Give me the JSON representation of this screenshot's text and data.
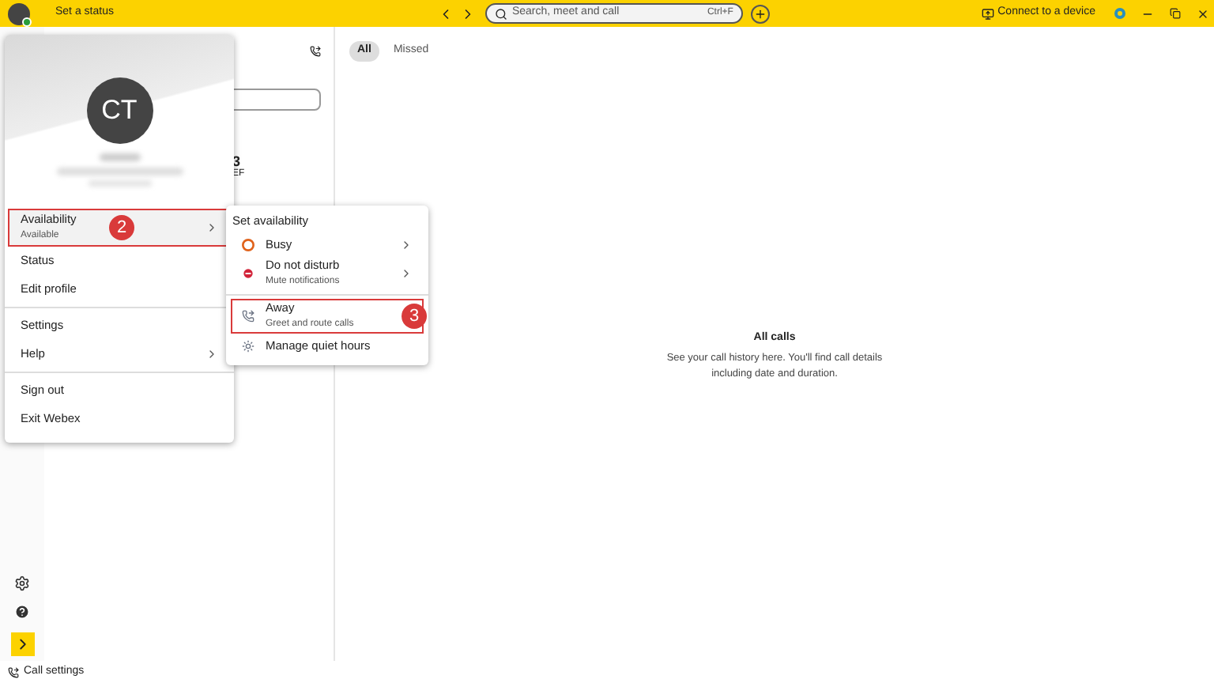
{
  "top_bar": {
    "status_text": "Set a status",
    "search": {
      "placeholder": "Search, meet and call",
      "shortcut": "Ctrl+F"
    },
    "connect": "Connect to a device"
  },
  "calls_panel": {
    "dialpad_key": {
      "digit": "3",
      "letters": "EF"
    }
  },
  "history": {
    "tabs": [
      {
        "label": "All",
        "selected": true
      },
      {
        "label": "Missed",
        "selected": false
      }
    ],
    "empty_title": "All calls",
    "empty_text": "See your call history here. You'll find call details including date and duration."
  },
  "footer": {
    "label": "Call settings"
  },
  "profile_menu": {
    "initials": "CT",
    "groups": [
      {
        "items": [
          {
            "label": "Availability",
            "sublabel": "Available",
            "submenu": true,
            "highlighted": true,
            "badge": "2"
          },
          {
            "label": "Status",
            "submenu": false,
            "highlighted": false
          },
          {
            "label": "Edit profile",
            "submenu": false,
            "highlighted": false
          }
        ]
      },
      {
        "items": [
          {
            "label": "Settings",
            "submenu": false,
            "highlighted": false
          },
          {
            "label": "Help",
            "submenu": true,
            "highlighted": false
          }
        ]
      },
      {
        "items": [
          {
            "label": "Sign out",
            "submenu": false,
            "highlighted": false
          },
          {
            "label": "Exit Webex",
            "submenu": false,
            "highlighted": false
          }
        ]
      }
    ]
  },
  "availability_menu": {
    "title": "Set availability",
    "groups": [
      {
        "items": [
          {
            "kind": "busy",
            "label": "Busy",
            "submenu": true,
            "highlighted": false
          },
          {
            "kind": "dnd",
            "label": "Do not disturb",
            "sublabel": "Mute notifications",
            "submenu": true,
            "highlighted": false
          }
        ]
      },
      {
        "items": [
          {
            "kind": "away",
            "label": "Away",
            "sublabel": "Greet and route calls",
            "submenu": false,
            "highlighted": true,
            "badge": "3"
          },
          {
            "kind": "quiet",
            "label": "Manage quiet hours",
            "submenu": false,
            "highlighted": false
          }
        ]
      }
    ]
  }
}
